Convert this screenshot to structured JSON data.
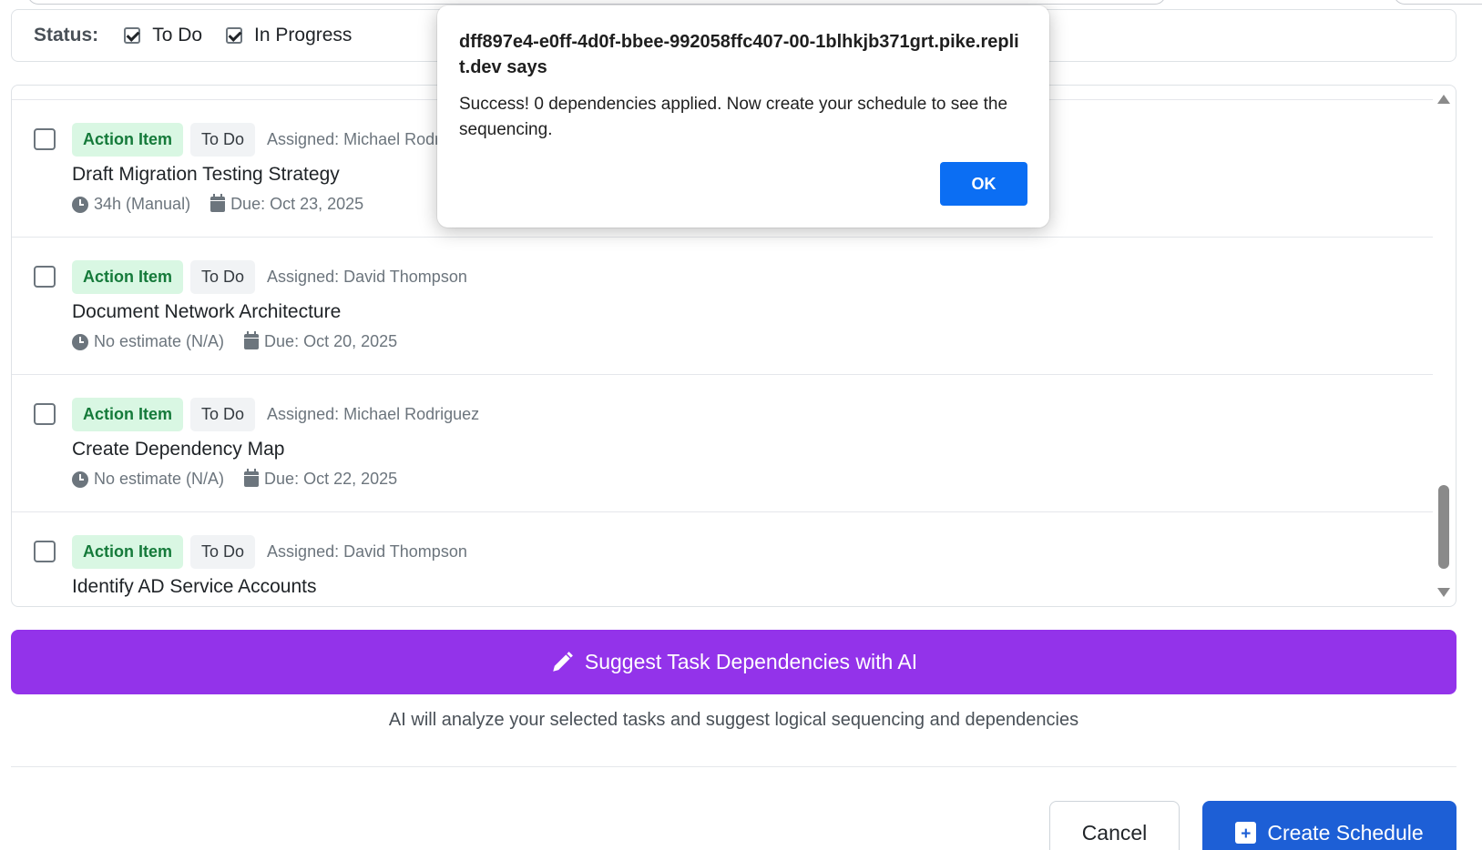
{
  "filters": {
    "label": "Status:",
    "options": [
      {
        "label": "To Do",
        "checked": true
      },
      {
        "label": "In Progress",
        "checked": true
      }
    ]
  },
  "tasks": [
    {
      "type": "Action Item",
      "status": "To Do",
      "assigned": "Assigned: Michael Rodriguez",
      "title": "Draft Migration Testing Strategy",
      "estimate": "34h (Manual)",
      "due": "Due: Oct 23, 2025"
    },
    {
      "type": "Action Item",
      "status": "To Do",
      "assigned": "Assigned: David Thompson",
      "title": "Document Network Architecture",
      "estimate": "No estimate (N/A)",
      "due": "Due: Oct 20, 2025"
    },
    {
      "type": "Action Item",
      "status": "To Do",
      "assigned": "Assigned: Michael Rodriguez",
      "title": "Create Dependency Map",
      "estimate": "No estimate (N/A)",
      "due": "Due: Oct 22, 2025"
    },
    {
      "type": "Action Item",
      "status": "To Do",
      "assigned": "Assigned: David Thompson",
      "title": "Identify AD Service Accounts",
      "estimate": "",
      "due": ""
    }
  ],
  "ai": {
    "button_label": "Suggest Task Dependencies with AI",
    "hint": "AI will analyze your selected tasks and suggest logical sequencing and dependencies"
  },
  "footer": {
    "cancel_label": "Cancel",
    "create_label": "Create Schedule"
  },
  "alert": {
    "title": "dff897e4-e0ff-4d0f-bbee-992058ffc407-00-1blhkjb371grt.pike.replit.dev says",
    "message": "Success! 0 dependencies applied. Now create your schedule to see the sequencing.",
    "ok_label": "OK"
  },
  "colors": {
    "ai_purple": "#9333ea",
    "primary_blue": "#1d5fd6",
    "badge_green_bg": "#d9f7e3",
    "badge_green_text": "#157a3a",
    "alert_ok_blue": "#0b6ef3"
  }
}
